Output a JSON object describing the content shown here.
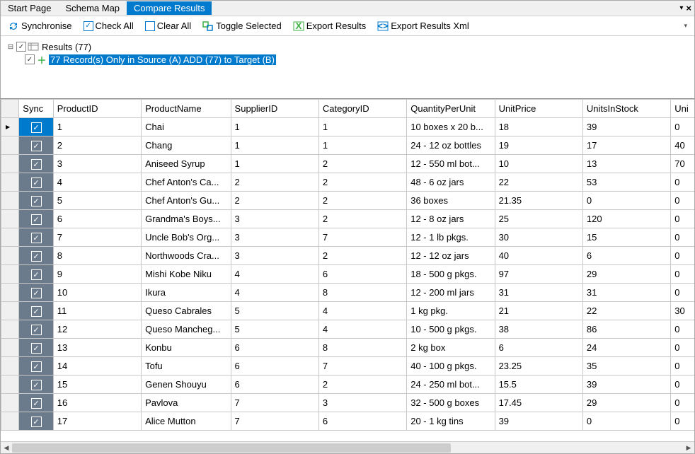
{
  "tabs": {
    "start": "Start Page",
    "schema": "Schema Map",
    "compare": "Compare Results"
  },
  "toolbar": {
    "sync": "Synchronise",
    "checkall": "Check All",
    "clearall": "Clear All",
    "toggle": "Toggle Selected",
    "export": "Export Results",
    "exportxml": "Export Results Xml"
  },
  "tree": {
    "root": "Results (77)",
    "child": "77 Record(s) Only in Source (A) ADD (77) to Target (B)"
  },
  "columns": {
    "sync": "Sync",
    "pid": "ProductID",
    "pname": "ProductName",
    "sid": "SupplierID",
    "cid": "CategoryID",
    "qpu": "QuantityPerUnit",
    "price": "UnitPrice",
    "stock": "UnitsInStock",
    "units": "Uni"
  },
  "rows": [
    {
      "pid": "1",
      "pname": "Chai",
      "sid": "1",
      "cid": "1",
      "qpu": "10 boxes x 20 b...",
      "price": "18",
      "stock": "39",
      "units": "0"
    },
    {
      "pid": "2",
      "pname": "Chang",
      "sid": "1",
      "cid": "1",
      "qpu": "24 - 12 oz bottles",
      "price": "19",
      "stock": "17",
      "units": "40"
    },
    {
      "pid": "3",
      "pname": "Aniseed Syrup",
      "sid": "1",
      "cid": "2",
      "qpu": "12 - 550 ml bot...",
      "price": "10",
      "stock": "13",
      "units": "70"
    },
    {
      "pid": "4",
      "pname": "Chef Anton's Ca...",
      "sid": "2",
      "cid": "2",
      "qpu": "48 - 6 oz jars",
      "price": "22",
      "stock": "53",
      "units": "0"
    },
    {
      "pid": "5",
      "pname": "Chef Anton's Gu...",
      "sid": "2",
      "cid": "2",
      "qpu": "36 boxes",
      "price": "21.35",
      "stock": "0",
      "units": "0"
    },
    {
      "pid": "6",
      "pname": "Grandma's Boys...",
      "sid": "3",
      "cid": "2",
      "qpu": "12 - 8 oz jars",
      "price": "25",
      "stock": "120",
      "units": "0"
    },
    {
      "pid": "7",
      "pname": "Uncle Bob's Org...",
      "sid": "3",
      "cid": "7",
      "qpu": "12 - 1 lb pkgs.",
      "price": "30",
      "stock": "15",
      "units": "0"
    },
    {
      "pid": "8",
      "pname": "Northwoods Cra...",
      "sid": "3",
      "cid": "2",
      "qpu": "12 - 12 oz jars",
      "price": "40",
      "stock": "6",
      "units": "0"
    },
    {
      "pid": "9",
      "pname": "Mishi Kobe Niku",
      "sid": "4",
      "cid": "6",
      "qpu": "18 - 500 g pkgs.",
      "price": "97",
      "stock": "29",
      "units": "0"
    },
    {
      "pid": "10",
      "pname": "Ikura",
      "sid": "4",
      "cid": "8",
      "qpu": "12 - 200 ml jars",
      "price": "31",
      "stock": "31",
      "units": "0"
    },
    {
      "pid": "11",
      "pname": "Queso Cabrales",
      "sid": "5",
      "cid": "4",
      "qpu": "1 kg pkg.",
      "price": "21",
      "stock": "22",
      "units": "30"
    },
    {
      "pid": "12",
      "pname": "Queso Mancheg...",
      "sid": "5",
      "cid": "4",
      "qpu": "10 - 500 g pkgs.",
      "price": "38",
      "stock": "86",
      "units": "0"
    },
    {
      "pid": "13",
      "pname": "Konbu",
      "sid": "6",
      "cid": "8",
      "qpu": "2 kg box",
      "price": "6",
      "stock": "24",
      "units": "0"
    },
    {
      "pid": "14",
      "pname": "Tofu",
      "sid": "6",
      "cid": "7",
      "qpu": "40 - 100 g pkgs.",
      "price": "23.25",
      "stock": "35",
      "units": "0"
    },
    {
      "pid": "15",
      "pname": "Genen Shouyu",
      "sid": "6",
      "cid": "2",
      "qpu": "24 - 250 ml bot...",
      "price": "15.5",
      "stock": "39",
      "units": "0"
    },
    {
      "pid": "16",
      "pname": "Pavlova",
      "sid": "7",
      "cid": "3",
      "qpu": "32 - 500 g boxes",
      "price": "17.45",
      "stock": "29",
      "units": "0"
    },
    {
      "pid": "17",
      "pname": "Alice Mutton",
      "sid": "7",
      "cid": "6",
      "qpu": "20 - 1 kg tins",
      "price": "39",
      "stock": "0",
      "units": "0"
    }
  ]
}
